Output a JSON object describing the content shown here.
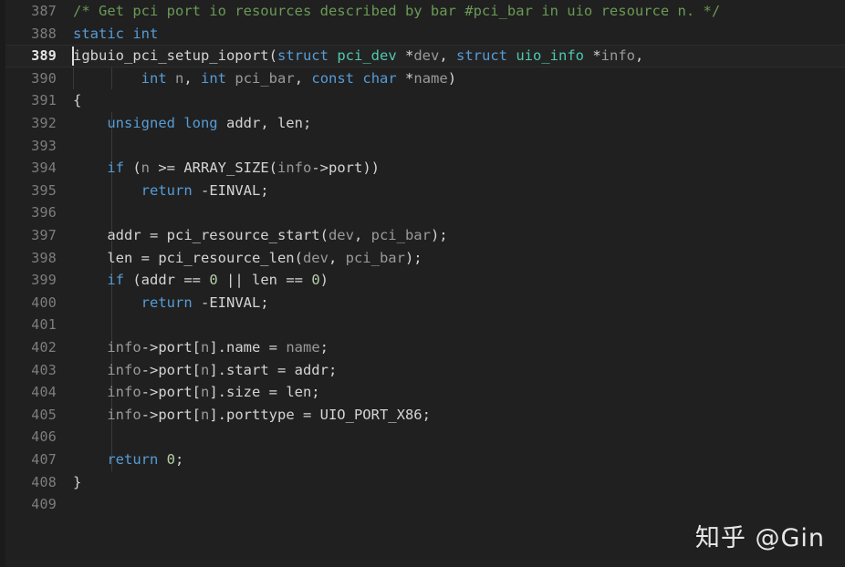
{
  "editor": {
    "theme_background": "#202020",
    "active_line_background": "#232323",
    "language": "c",
    "watermark": "知乎 @Gin",
    "colors": {
      "comment": "#6a9955",
      "keyword": "#569cd6",
      "type": "#4ec9b0",
      "parameter": "#9a9a9a",
      "number": "#b5cea8",
      "plain": "#d4d4d4",
      "line_number": "#7d7d7d",
      "active_line_number": "#e6e6e6",
      "indent_guide": "#3a3a3a"
    },
    "first_visible_line": 387,
    "last_visible_line": 409,
    "active_line": 389,
    "cursor_line": 389,
    "cursor_column": 1
  },
  "lines": [
    {
      "number": "387",
      "active": false,
      "guides": [],
      "tokens": [
        {
          "t": "/* Get pci port io resources described by bar #pci_bar in uio resource n. */",
          "c": "cmt"
        }
      ]
    },
    {
      "number": "388",
      "active": false,
      "guides": [],
      "tokens": [
        {
          "t": "static int",
          "c": "kw"
        }
      ]
    },
    {
      "number": "389",
      "active": true,
      "guides": [],
      "tokens": [
        {
          "t": "igbuio_pci_setup_ioport",
          "c": "pln"
        },
        {
          "t": "(",
          "c": "pln"
        },
        {
          "t": "struct",
          "c": "kw"
        },
        {
          "t": " ",
          "c": "pln"
        },
        {
          "t": "pci_dev",
          "c": "typ"
        },
        {
          "t": " *",
          "c": "pln"
        },
        {
          "t": "dev",
          "c": "par"
        },
        {
          "t": ", ",
          "c": "pln"
        },
        {
          "t": "struct",
          "c": "kw"
        },
        {
          "t": " ",
          "c": "pln"
        },
        {
          "t": "uio_info",
          "c": "typ"
        },
        {
          "t": " *",
          "c": "pln"
        },
        {
          "t": "info",
          "c": "par"
        },
        {
          "t": ",",
          "c": "pln"
        }
      ]
    },
    {
      "number": "390",
      "active": false,
      "guides": [
        0,
        42
      ],
      "tokens": [
        {
          "t": "        ",
          "c": "pln"
        },
        {
          "t": "int",
          "c": "kw"
        },
        {
          "t": " ",
          "c": "pln"
        },
        {
          "t": "n",
          "c": "par"
        },
        {
          "t": ", ",
          "c": "pln"
        },
        {
          "t": "int",
          "c": "kw"
        },
        {
          "t": " ",
          "c": "pln"
        },
        {
          "t": "pci_bar",
          "c": "par"
        },
        {
          "t": ", ",
          "c": "pln"
        },
        {
          "t": "const",
          "c": "kw"
        },
        {
          "t": " ",
          "c": "pln"
        },
        {
          "t": "char",
          "c": "kw"
        },
        {
          "t": " *",
          "c": "pln"
        },
        {
          "t": "name",
          "c": "par"
        },
        {
          "t": ")",
          "c": "pln"
        }
      ]
    },
    {
      "number": "391",
      "active": false,
      "guides": [],
      "tokens": [
        {
          "t": "{",
          "c": "pln"
        }
      ]
    },
    {
      "number": "392",
      "active": false,
      "guides": [
        42
      ],
      "tokens": [
        {
          "t": "    ",
          "c": "pln"
        },
        {
          "t": "unsigned long",
          "c": "kw"
        },
        {
          "t": " addr, len;",
          "c": "pln"
        }
      ]
    },
    {
      "number": "393",
      "active": false,
      "guides": [
        42
      ],
      "tokens": []
    },
    {
      "number": "394",
      "active": false,
      "guides": [
        42
      ],
      "tokens": [
        {
          "t": "    ",
          "c": "pln"
        },
        {
          "t": "if",
          "c": "ctl"
        },
        {
          "t": " (",
          "c": "pln"
        },
        {
          "t": "n",
          "c": "par"
        },
        {
          "t": " >= ARRAY_SIZE(",
          "c": "pln"
        },
        {
          "t": "info",
          "c": "par"
        },
        {
          "t": "->port))",
          "c": "pln"
        }
      ]
    },
    {
      "number": "395",
      "active": false,
      "guides": [
        42
      ],
      "tokens": [
        {
          "t": "        ",
          "c": "pln"
        },
        {
          "t": "return",
          "c": "ctl"
        },
        {
          "t": " -EINVAL;",
          "c": "pln"
        }
      ]
    },
    {
      "number": "396",
      "active": false,
      "guides": [
        42
      ],
      "tokens": []
    },
    {
      "number": "397",
      "active": false,
      "guides": [
        42
      ],
      "tokens": [
        {
          "t": "    addr = pci_resource_start(",
          "c": "pln"
        },
        {
          "t": "dev",
          "c": "par"
        },
        {
          "t": ", ",
          "c": "pln"
        },
        {
          "t": "pci_bar",
          "c": "par"
        },
        {
          "t": ");",
          "c": "pln"
        }
      ]
    },
    {
      "number": "398",
      "active": false,
      "guides": [
        42
      ],
      "tokens": [
        {
          "t": "    len = pci_resource_len(",
          "c": "pln"
        },
        {
          "t": "dev",
          "c": "par"
        },
        {
          "t": ", ",
          "c": "pln"
        },
        {
          "t": "pci_bar",
          "c": "par"
        },
        {
          "t": ");",
          "c": "pln"
        }
      ]
    },
    {
      "number": "399",
      "active": false,
      "guides": [
        42
      ],
      "tokens": [
        {
          "t": "    ",
          "c": "pln"
        },
        {
          "t": "if",
          "c": "ctl"
        },
        {
          "t": " (addr == ",
          "c": "pln"
        },
        {
          "t": "0",
          "c": "num"
        },
        {
          "t": " || len == ",
          "c": "pln"
        },
        {
          "t": "0",
          "c": "num"
        },
        {
          "t": ")",
          "c": "pln"
        }
      ]
    },
    {
      "number": "400",
      "active": false,
      "guides": [
        42
      ],
      "tokens": [
        {
          "t": "        ",
          "c": "pln"
        },
        {
          "t": "return",
          "c": "ctl"
        },
        {
          "t": " -EINVAL;",
          "c": "pln"
        }
      ]
    },
    {
      "number": "401",
      "active": false,
      "guides": [
        42
      ],
      "tokens": []
    },
    {
      "number": "402",
      "active": false,
      "guides": [
        42
      ],
      "tokens": [
        {
          "t": "    ",
          "c": "pln"
        },
        {
          "t": "info",
          "c": "par"
        },
        {
          "t": "->port[",
          "c": "pln"
        },
        {
          "t": "n",
          "c": "par"
        },
        {
          "t": "].name = ",
          "c": "pln"
        },
        {
          "t": "name",
          "c": "par"
        },
        {
          "t": ";",
          "c": "pln"
        }
      ]
    },
    {
      "number": "403",
      "active": false,
      "guides": [
        42
      ],
      "tokens": [
        {
          "t": "    ",
          "c": "pln"
        },
        {
          "t": "info",
          "c": "par"
        },
        {
          "t": "->port[",
          "c": "pln"
        },
        {
          "t": "n",
          "c": "par"
        },
        {
          "t": "].start = addr;",
          "c": "pln"
        }
      ]
    },
    {
      "number": "404",
      "active": false,
      "guides": [
        42
      ],
      "tokens": [
        {
          "t": "    ",
          "c": "pln"
        },
        {
          "t": "info",
          "c": "par"
        },
        {
          "t": "->port[",
          "c": "pln"
        },
        {
          "t": "n",
          "c": "par"
        },
        {
          "t": "].size = len;",
          "c": "pln"
        }
      ]
    },
    {
      "number": "405",
      "active": false,
      "guides": [
        42
      ],
      "tokens": [
        {
          "t": "    ",
          "c": "pln"
        },
        {
          "t": "info",
          "c": "par"
        },
        {
          "t": "->port[",
          "c": "pln"
        },
        {
          "t": "n",
          "c": "par"
        },
        {
          "t": "].porttype = UIO_PORT_X86;",
          "c": "pln"
        }
      ]
    },
    {
      "number": "406",
      "active": false,
      "guides": [
        42
      ],
      "tokens": []
    },
    {
      "number": "407",
      "active": false,
      "guides": [
        42
      ],
      "tokens": [
        {
          "t": "    ",
          "c": "pln"
        },
        {
          "t": "return",
          "c": "ctl"
        },
        {
          "t": " ",
          "c": "pln"
        },
        {
          "t": "0",
          "c": "num"
        },
        {
          "t": ";",
          "c": "pln"
        }
      ]
    },
    {
      "number": "408",
      "active": false,
      "guides": [],
      "tokens": [
        {
          "t": "}",
          "c": "pln"
        }
      ]
    },
    {
      "number": "409",
      "active": false,
      "guides": [],
      "tokens": []
    }
  ]
}
